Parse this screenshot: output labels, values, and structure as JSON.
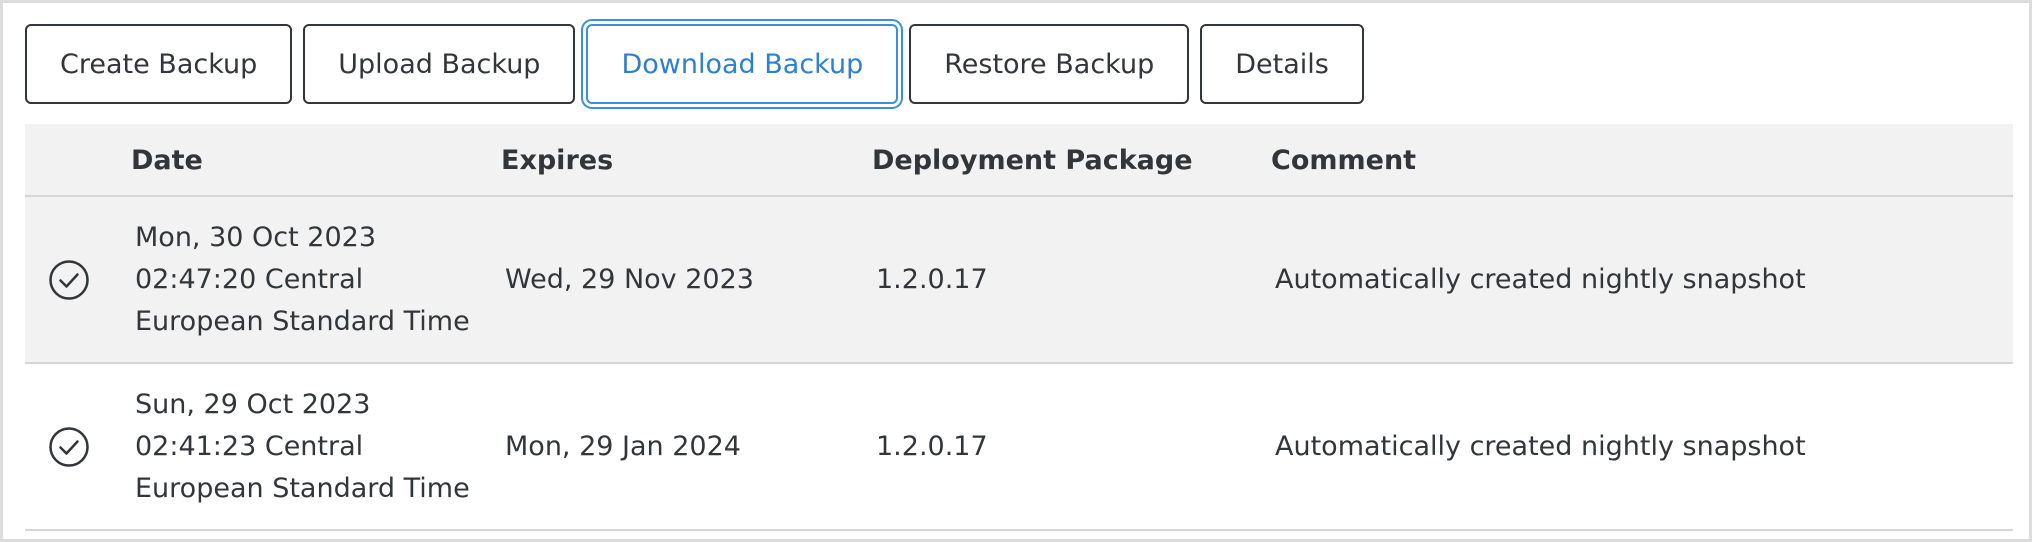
{
  "toolbar": {
    "buttons": [
      {
        "label": "Create Backup"
      },
      {
        "label": "Upload Backup"
      },
      {
        "label": "Download Backup"
      },
      {
        "label": "Restore Backup"
      },
      {
        "label": "Details"
      }
    ],
    "focused_index": 2
  },
  "table": {
    "columns": [
      "Date",
      "Expires",
      "Deployment Package",
      "Comment"
    ],
    "rows": [
      {
        "status_icon": "check-circle-icon",
        "date_lines": [
          "Mon, 30 Oct 2023",
          "02:47:20 Central",
          "European Standard Time"
        ],
        "expires": "Wed, 29 Nov 2023",
        "package": "1.2.0.17",
        "comment": "Automatically created nightly snapshot"
      },
      {
        "status_icon": "check-circle-icon",
        "date_lines": [
          "Sun, 29 Oct 2023",
          "02:41:23 Central",
          "European Standard Time"
        ],
        "expires": "Mon, 29 Jan 2024",
        "package": "1.2.0.17",
        "comment": "Automatically created nightly snapshot"
      }
    ]
  },
  "colors": {
    "text": "#32363a",
    "focus_accent": "#3c8fdc",
    "header_bg": "#f2f2f2",
    "row_alt_bg": "#f2f2f2",
    "divider": "#d6d6d6"
  }
}
